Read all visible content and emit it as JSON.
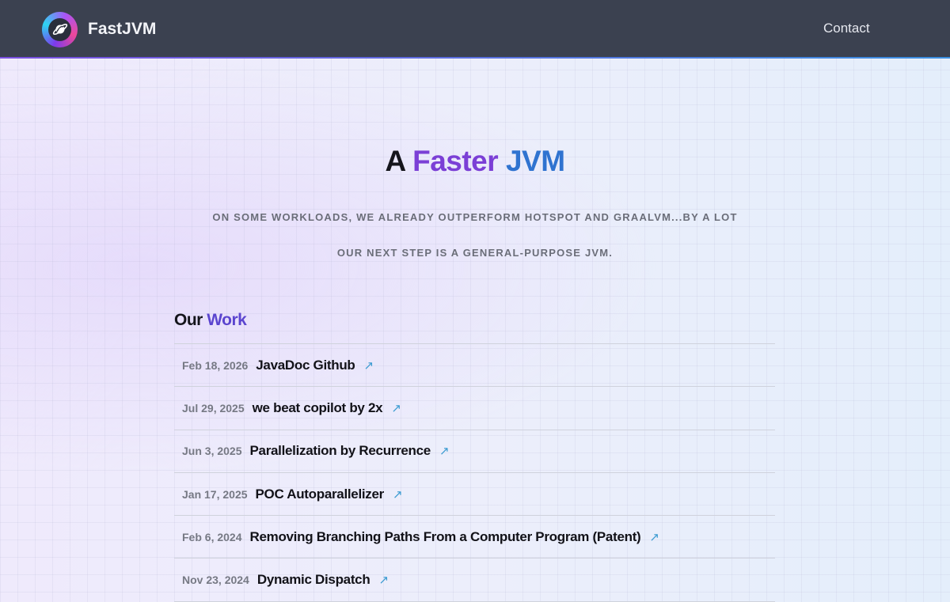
{
  "header": {
    "brand": "FastJVM",
    "logo_icon": "planet-leaf-logo",
    "nav_contact": "Contact"
  },
  "hero": {
    "title_a": "A",
    "title_faster": "Faster",
    "title_jvm": "JVM",
    "subtitle_1": "ON SOME WORKLOADS, WE ALREADY OUTPERFORM HOTSPOT AND GRAALVM...BY A LOT",
    "subtitle_2": "OUR NEXT STEP IS A GENERAL-PURPOSE JVM."
  },
  "work": {
    "heading_a": "Our",
    "heading_b": "Work",
    "items": [
      {
        "date": "Feb 18, 2026",
        "title": "JavaDoc Github",
        "arrow": "↗"
      },
      {
        "date": "Jul 29, 2025",
        "title": "we beat copilot by 2x",
        "arrow": "↗"
      },
      {
        "date": "Jun 3, 2025",
        "title": "Parallelization by Recurrence",
        "arrow": "↗"
      },
      {
        "date": "Jan 17, 2025",
        "title": "POC Autoparallelizer",
        "arrow": "↗"
      },
      {
        "date": "Feb 6, 2024",
        "title": "Removing Branching Paths From a Computer Program (Patent)",
        "arrow": "↗"
      },
      {
        "date": "Nov 23, 2024",
        "title": "Dynamic Dispatch",
        "arrow": "↗"
      }
    ]
  },
  "colors": {
    "header_bg": "#3b4150",
    "accent_purple": "#7b3fd6",
    "accent_blue": "#2f73d0",
    "link_arrow": "#3a9bd1"
  }
}
